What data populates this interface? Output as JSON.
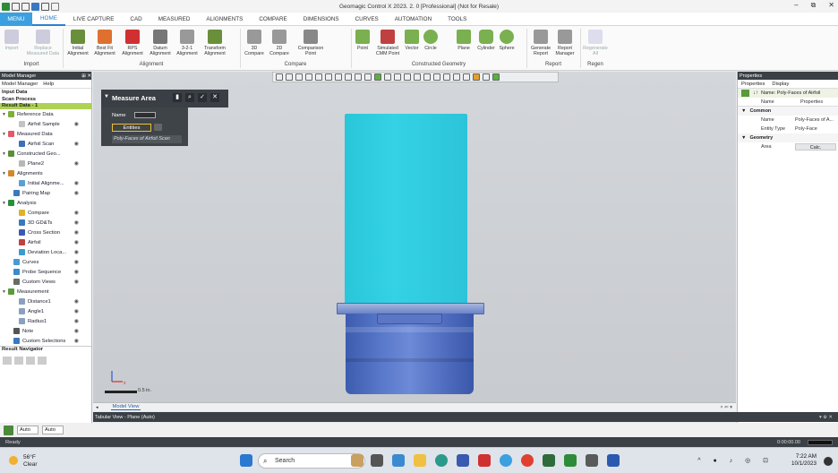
{
  "app": {
    "title": "Geomagic Control X 2023. 2. 0 [Professional] (Not for Resale)",
    "window_controls": [
      "–",
      "⧉",
      "✕"
    ]
  },
  "tabs": {
    "menu": "MENU",
    "items": [
      "HOME",
      "LIVE CAPTURE",
      "CAD",
      "MEASURED",
      "ALIGNMENTS",
      "COMPARE",
      "DIMENSIONS",
      "CURVES",
      "AUTOMATION",
      "TOOLS"
    ],
    "active": "HOME"
  },
  "ribbon": {
    "import": {
      "label": "Import",
      "buttons": [
        "Import",
        "Replace Measured Data"
      ]
    },
    "alignment": {
      "label": "Alignment",
      "buttons": [
        "Initial Alignment",
        "Best Fit Alignment",
        "RPS Alignment",
        "Datum Alignment",
        "3-2-1 Alignment",
        "Transform Alignment"
      ]
    },
    "compare": {
      "label": "Compare",
      "buttons": [
        "3D Compare",
        "2D Compare",
        "Comparison Point"
      ]
    },
    "constructed": {
      "label": "Constructed Geometry",
      "buttons": [
        "Point",
        "Simulated CMM Point",
        "Vector",
        "Circle",
        "Plane",
        "Cylinder",
        "Sphere"
      ]
    },
    "report": {
      "label": "Report",
      "buttons": [
        "Generate Report",
        "Report Manager"
      ]
    },
    "regen": {
      "label": "Regen",
      "buttons": [
        "Regenerate All"
      ]
    }
  },
  "left_panel": {
    "header": "Model Manager",
    "sub_tabs": [
      "Model Manager",
      "Help"
    ],
    "input_data": "Input Data",
    "scan_process": "Scan Process",
    "result_data": "Result Data - 1",
    "tree": [
      {
        "label": "Reference Data",
        "indent": 0,
        "color": "#7fae3a"
      },
      {
        "label": "Airfoil Sample",
        "indent": 2,
        "color": "#c3c3c3"
      },
      {
        "label": "Measured Data",
        "indent": 0,
        "color": "#e05a6a"
      },
      {
        "label": "Airfoil Scan",
        "indent": 2,
        "color": "#3b6fb8"
      },
      {
        "label": "Constructed Geo...",
        "indent": 0,
        "color": "#5a8f3a"
      },
      {
        "label": "Plane2",
        "indent": 2,
        "color": "#b7b7b7"
      },
      {
        "label": "Alignments",
        "indent": 0,
        "color": "#d08a2a"
      },
      {
        "label": "Initial Alignme...",
        "indent": 2,
        "color": "#5aa0d0"
      },
      {
        "label": "Pairing Map",
        "indent": 1,
        "color": "#3a78c0"
      },
      {
        "label": "Analysis",
        "indent": 0,
        "color": "#2a8f3a"
      },
      {
        "label": "Compare",
        "indent": 2,
        "color": "#e0b02a"
      },
      {
        "label": "3D GD&Ts",
        "indent": 2,
        "color": "#3a78c0"
      },
      {
        "label": "Cross Section",
        "indent": 2,
        "color": "#3a5ab0"
      },
      {
        "label": "Airfoil",
        "indent": 2,
        "color": "#c04040"
      },
      {
        "label": "Deviation Loca...",
        "indent": 2,
        "color": "#3a9ad0"
      },
      {
        "label": "Curves",
        "indent": 1,
        "color": "#4a9ad0"
      },
      {
        "label": "Probe Sequence",
        "indent": 1,
        "color": "#3a8ad0"
      },
      {
        "label": "Custom Views",
        "indent": 1,
        "color": "#6a6a6a"
      },
      {
        "label": "Measurement",
        "indent": 0,
        "color": "#5a9a3a"
      },
      {
        "label": "Distance1",
        "indent": 2,
        "color": "#8aa0c0"
      },
      {
        "label": "Angle1",
        "indent": 2,
        "color": "#8aa0c0"
      },
      {
        "label": "Radius1",
        "indent": 2,
        "color": "#8aa0c0"
      },
      {
        "label": "Note",
        "indent": 1,
        "color": "#555555"
      },
      {
        "label": "Custom Selections",
        "indent": 1,
        "color": "#3a78c0"
      }
    ],
    "result_navigator": "Result Navigator"
  },
  "measure_panel": {
    "title": "Measure Area",
    "name_label": "Name",
    "entities_label": "Entities",
    "entity_value": "Poly-Faces of Airfoil Scan"
  },
  "viewport": {
    "scale_label": "0.5 in.",
    "tab": "Model View",
    "tab_controls": "× ⇐ ▾"
  },
  "properties": {
    "header": "Properties",
    "tabs": [
      "Properties",
      "Display"
    ],
    "selected_name": "Name: Poly-Faces of Airfoil",
    "columns": [
      "Name",
      "Properties"
    ],
    "common": "Common",
    "name_key": "Name",
    "name_val": "Poly-Faces of A...",
    "type_key": "Entity Type",
    "type_val": "Poly-Face",
    "geometry": "Geometry",
    "area_key": "Area",
    "area_val": "Calc."
  },
  "tabular": {
    "title": "Tabular View - Plane (Auto)",
    "controls": "▾ ⊕ ✕"
  },
  "bottom_tools": {
    "auto1": "Auto",
    "auto2": "Auto"
  },
  "status": {
    "text": "Ready",
    "time": "0:00:00.00"
  },
  "taskbar": {
    "weather_temp": "56°F",
    "weather_desc": "Clear",
    "search": "Search",
    "clock_time": "7:22 AM",
    "clock_date": "10/1/2023"
  }
}
